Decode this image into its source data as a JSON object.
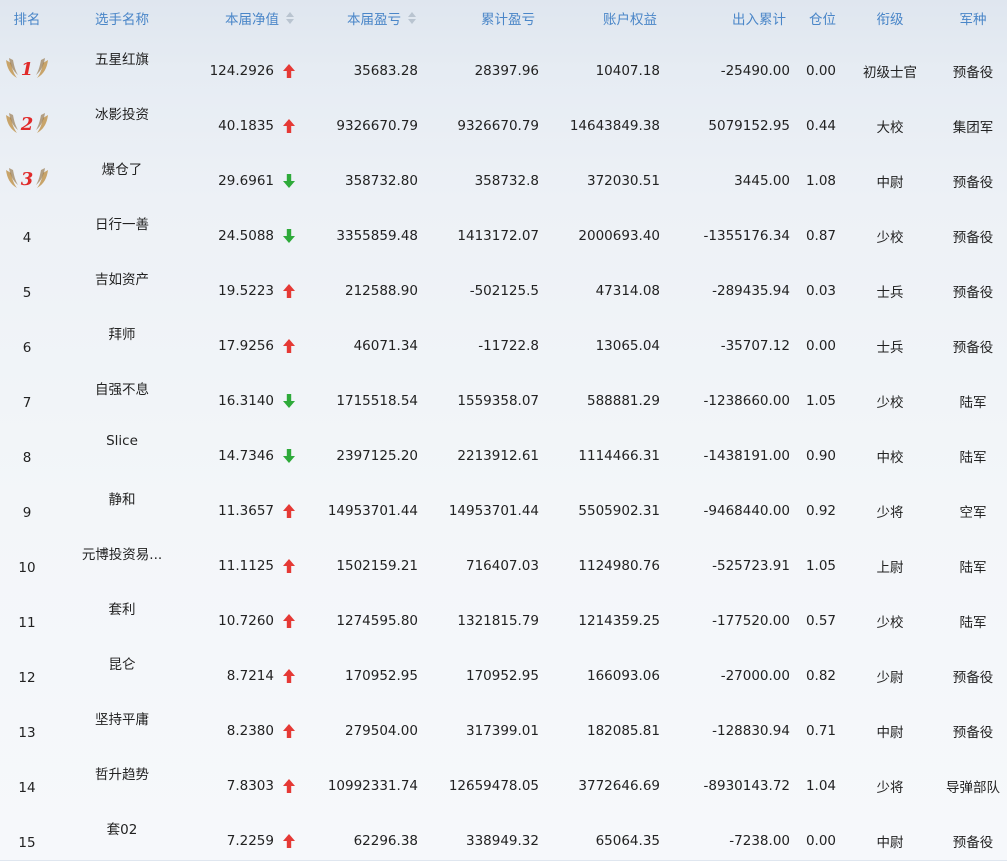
{
  "header": {
    "rank": "排名",
    "name": "选手名称",
    "nav": "本届净值",
    "pnl": "本届盈亏",
    "cumulative": "累计盈亏",
    "equity": "账户权益",
    "flow": "出入累计",
    "position": "仓位",
    "title": "衔级",
    "branch": "军种"
  },
  "colors": {
    "header_text": "#4a86c8",
    "up": "#e53935",
    "down": "#2eaa3a",
    "badge_gold": "#c8a46a",
    "badge_number": "#e02a2a"
  },
  "rows": [
    {
      "rank": "1",
      "badge": true,
      "name": "五星红旗",
      "nav": "124.2926",
      "trend": "up",
      "pnl": "35683.28",
      "cumulative": "28397.96",
      "equity": "10407.18",
      "flow": "-25490.00",
      "position": "0.00",
      "title": "初级士官",
      "branch": "预备役"
    },
    {
      "rank": "2",
      "badge": true,
      "name": "冰影投资",
      "nav": "40.1835",
      "trend": "up",
      "pnl": "9326670.79",
      "cumulative": "9326670.79",
      "equity": "14643849.38",
      "flow": "5079152.95",
      "position": "0.44",
      "title": "大校",
      "branch": "集团军"
    },
    {
      "rank": "3",
      "badge": true,
      "name": "爆仓了",
      "nav": "29.6961",
      "trend": "down",
      "pnl": "358732.80",
      "cumulative": "358732.8",
      "equity": "372030.51",
      "flow": "3445.00",
      "position": "1.08",
      "title": "中尉",
      "branch": "预备役"
    },
    {
      "rank": "4",
      "badge": false,
      "name": "日行一善",
      "nav": "24.5088",
      "trend": "down",
      "pnl": "3355859.48",
      "cumulative": "1413172.07",
      "equity": "2000693.40",
      "flow": "-1355176.34",
      "position": "0.87",
      "title": "少校",
      "branch": "预备役"
    },
    {
      "rank": "5",
      "badge": false,
      "name": "吉如资产",
      "nav": "19.5223",
      "trend": "up",
      "pnl": "212588.90",
      "cumulative": "-502125.5",
      "equity": "47314.08",
      "flow": "-289435.94",
      "position": "0.03",
      "title": "士兵",
      "branch": "预备役"
    },
    {
      "rank": "6",
      "badge": false,
      "name": "拜师",
      "nav": "17.9256",
      "trend": "up",
      "pnl": "46071.34",
      "cumulative": "-11722.8",
      "equity": "13065.04",
      "flow": "-35707.12",
      "position": "0.00",
      "title": "士兵",
      "branch": "预备役"
    },
    {
      "rank": "7",
      "badge": false,
      "name": "自强不息",
      "nav": "16.3140",
      "trend": "down",
      "pnl": "1715518.54",
      "cumulative": "1559358.07",
      "equity": "588881.29",
      "flow": "-1238660.00",
      "position": "1.05",
      "title": "少校",
      "branch": "陆军"
    },
    {
      "rank": "8",
      "badge": false,
      "name": "Slice",
      "nav": "14.7346",
      "trend": "down",
      "pnl": "2397125.20",
      "cumulative": "2213912.61",
      "equity": "1114466.31",
      "flow": "-1438191.00",
      "position": "0.90",
      "title": "中校",
      "branch": "陆军"
    },
    {
      "rank": "9",
      "badge": false,
      "name": "静和",
      "nav": "11.3657",
      "trend": "up",
      "pnl": "14953701.44",
      "cumulative": "14953701.44",
      "equity": "5505902.31",
      "flow": "-9468440.00",
      "position": "0.92",
      "title": "少将",
      "branch": "空军"
    },
    {
      "rank": "10",
      "badge": false,
      "name": "元博投资易...",
      "nav": "11.1125",
      "trend": "up",
      "pnl": "1502159.21",
      "cumulative": "716407.03",
      "equity": "1124980.76",
      "flow": "-525723.91",
      "position": "1.05",
      "title": "上尉",
      "branch": "陆军"
    },
    {
      "rank": "11",
      "badge": false,
      "name": "套利",
      "nav": "10.7260",
      "trend": "up",
      "pnl": "1274595.80",
      "cumulative": "1321815.79",
      "equity": "1214359.25",
      "flow": "-177520.00",
      "position": "0.57",
      "title": "少校",
      "branch": "陆军"
    },
    {
      "rank": "12",
      "badge": false,
      "name": "昆仑",
      "nav": "8.7214",
      "trend": "up",
      "pnl": "170952.95",
      "cumulative": "170952.95",
      "equity": "166093.06",
      "flow": "-27000.00",
      "position": "0.82",
      "title": "少尉",
      "branch": "预备役"
    },
    {
      "rank": "13",
      "badge": false,
      "name": "坚持平庸",
      "nav": "8.2380",
      "trend": "up",
      "pnl": "279504.00",
      "cumulative": "317399.01",
      "equity": "182085.81",
      "flow": "-128830.94",
      "position": "0.71",
      "title": "中尉",
      "branch": "预备役"
    },
    {
      "rank": "14",
      "badge": false,
      "name": "哲升趋势",
      "nav": "7.8303",
      "trend": "up",
      "pnl": "10992331.74",
      "cumulative": "12659478.05",
      "equity": "3772646.69",
      "flow": "-8930143.72",
      "position": "1.04",
      "title": "少将",
      "branch": "导弹部队"
    },
    {
      "rank": "15",
      "badge": false,
      "name": "套02",
      "nav": "7.2259",
      "trend": "up",
      "pnl": "62296.38",
      "cumulative": "338949.32",
      "equity": "65064.35",
      "flow": "-7238.00",
      "position": "0.00",
      "title": "中尉",
      "branch": "预备役"
    }
  ]
}
